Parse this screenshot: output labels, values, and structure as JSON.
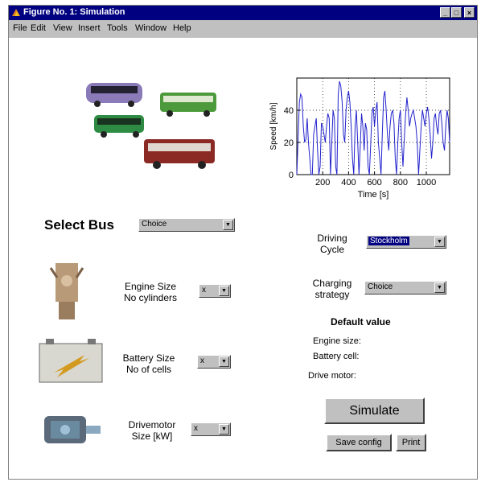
{
  "window": {
    "title": "Figure No. 1: Simulation"
  },
  "menu": [
    "File",
    "Edit",
    "View",
    "Insert",
    "Tools",
    "Window",
    "Help"
  ],
  "chart_data": {
    "type": "line",
    "xlabel": "Time [s]",
    "ylabel": "Speed [km/h]",
    "xlim": [
      0,
      1180
    ],
    "ylim": [
      0,
      60
    ],
    "xticks": [
      200,
      400,
      600,
      800,
      1000
    ],
    "yticks": [
      0,
      20,
      40
    ],
    "grid": true,
    "x": [
      0,
      20,
      30,
      40,
      50,
      60,
      70,
      80,
      90,
      100,
      110,
      120,
      130,
      140,
      150,
      160,
      170,
      180,
      190,
      200,
      210,
      220,
      230,
      240,
      250,
      260,
      270,
      280,
      290,
      300,
      310,
      320,
      330,
      340,
      350,
      360,
      370,
      380,
      390,
      400,
      410,
      420,
      430,
      440,
      450,
      460,
      470,
      480,
      490,
      500,
      510,
      520,
      530,
      540,
      550,
      560,
      570,
      580,
      590,
      600,
      610,
      620,
      630,
      640,
      650,
      660,
      670,
      680,
      690,
      700,
      710,
      720,
      730,
      740,
      750,
      760,
      770,
      780,
      790,
      800,
      810,
      820,
      830,
      840,
      850,
      860,
      870,
      880,
      890,
      900,
      910,
      920,
      930,
      940,
      950,
      960,
      970,
      980,
      990,
      1000,
      1010,
      1020,
      1030,
      1040,
      1050,
      1060,
      1070,
      1080,
      1090,
      1100,
      1110,
      1120,
      1130,
      1140,
      1150,
      1160,
      1170,
      1180
    ],
    "y": [
      0,
      45,
      50,
      48,
      30,
      20,
      22,
      35,
      20,
      10,
      0,
      0,
      25,
      30,
      35,
      15,
      0,
      5,
      32,
      30,
      25,
      20,
      30,
      38,
      35,
      0,
      20,
      40,
      35,
      5,
      0,
      50,
      58,
      55,
      45,
      25,
      20,
      40,
      48,
      52,
      45,
      30,
      10,
      0,
      30,
      40,
      20,
      0,
      18,
      38,
      30,
      15,
      32,
      28,
      5,
      0,
      18,
      38,
      42,
      30,
      40,
      45,
      20,
      10,
      0,
      25,
      48,
      52,
      40,
      25,
      15,
      30,
      38,
      40,
      32,
      10,
      0,
      20,
      35,
      40,
      20,
      5,
      22,
      38,
      48,
      40,
      30,
      35,
      38,
      40,
      35,
      30,
      20,
      0,
      15,
      30,
      40,
      35,
      30,
      38,
      42,
      35,
      25,
      10,
      20,
      35,
      38,
      30,
      25,
      38,
      40,
      32,
      20,
      15,
      30,
      40,
      35,
      20
    ]
  },
  "bus": {
    "label": "Select Bus",
    "value": "Choice"
  },
  "engine": {
    "label_line1": "Engine Size",
    "label_line2": "No cylinders",
    "value": "x"
  },
  "battery": {
    "label_line1": "Battery Size",
    "label_line2": "No of cells",
    "value": "x"
  },
  "drivemotor": {
    "label_line1": "Drivemotor",
    "label_line2": "Size [kW]",
    "value": "x"
  },
  "cycle": {
    "label_line1": "Driving",
    "label_line2": "Cycle",
    "value": "Stockholm"
  },
  "charging": {
    "label_line1": "Charging",
    "label_line2": "strategy",
    "value": "Choice"
  },
  "defaults": {
    "title": "Default value",
    "engine": "Engine size:",
    "battery": "Battery cell:",
    "motor": "Drive motor:"
  },
  "buttons": {
    "simulate": "Simulate",
    "save": "Save config",
    "print": "Print"
  },
  "colors": {
    "title_bar": "#000080",
    "plot_line": "#2222cc",
    "selected": "#000080"
  }
}
